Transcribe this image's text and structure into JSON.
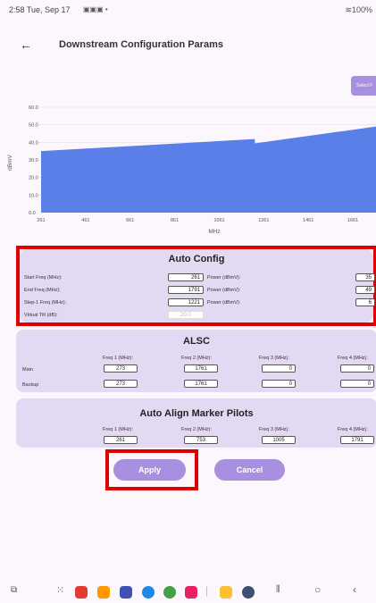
{
  "status_bar": {
    "time_date": "2:58  Tue, Sep 17",
    "battery": "100%"
  },
  "header": {
    "title": "Downstream Configuration Params",
    "select_button": "Select F"
  },
  "chart_data": {
    "type": "area",
    "ylabel": "dBmV",
    "xlabel": "MHz",
    "ylim": [
      0,
      60
    ],
    "yticks": [
      "0.0",
      "10.0",
      "20.0",
      "30.0",
      "40.0",
      "50.0",
      "60.0"
    ],
    "xticks": [
      "261",
      "461",
      "661",
      "861",
      "1061",
      "1261",
      "1461",
      "1661"
    ],
    "x": [
      261,
      1221,
      1221,
      1791
    ],
    "y": [
      35,
      41.9,
      39.4,
      49
    ],
    "color": "#5b7fe8",
    "grid": true
  },
  "auto_config": {
    "title": "Auto Config",
    "rows": [
      {
        "label": "Start Freq (MHz):",
        "freq": "261",
        "power_label": "Power (dBmV):",
        "power": "35"
      },
      {
        "label": "End Freq (MHz):",
        "freq": "1791",
        "power_label": "Power (dBmV):",
        "power": "49"
      },
      {
        "label": "Step-1 Freq (MHz):",
        "freq": "1221",
        "power_label": "Power (dBmV):",
        "power": "6"
      }
    ],
    "tilt_label": "Virtual Tilt (dB):",
    "tilt_value": "20.0"
  },
  "alsc": {
    "title": "ALSC",
    "headers": [
      "Freq 1 (MHz):",
      "Freq 2 (MHz):",
      "Freq 3 (MHz):",
      "Freq 4 (MHz):"
    ],
    "main_label": "Main",
    "backup_label": "Backup",
    "main": [
      "273",
      "1761",
      "0",
      "0"
    ],
    "backup": [
      "273",
      "1761",
      "0",
      "0"
    ]
  },
  "pilots": {
    "title": "Auto Align Marker Pilots",
    "headers": [
      "Freq 1 (MHz):",
      "Freq 2 (MHz):",
      "Freq 3 (MHz):",
      "Freq 4 (MHz):"
    ],
    "values": [
      "261",
      "753",
      "1005",
      "1791"
    ]
  },
  "actions": {
    "apply": "Apply",
    "cancel": "Cancel"
  },
  "colors": {
    "accent": "#a88fe0",
    "highlight": "#e10000",
    "card": "#e3d9f3"
  }
}
